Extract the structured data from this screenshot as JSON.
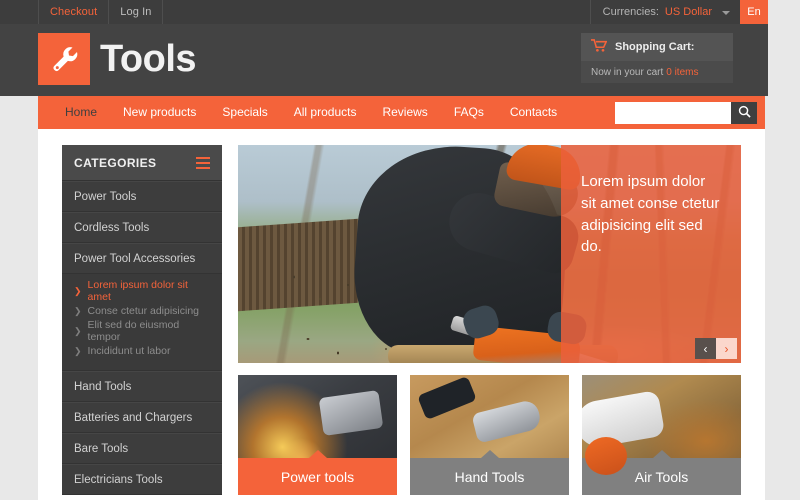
{
  "topbar": {
    "links": [
      {
        "label": "Checkout",
        "accent": true
      },
      {
        "label": "Log In",
        "accent": false
      }
    ],
    "currency_label": "Currencies:",
    "currency_value": "US Dollar",
    "language": "En"
  },
  "header": {
    "logo_text": "Tools",
    "logo_icon": "wrench-icon",
    "cart_title": "Shopping Cart:",
    "cart_icon": "shopping-cart-icon",
    "cart_status_prefix": "Now in your cart",
    "cart_count": "0 items"
  },
  "nav": {
    "items": [
      {
        "label": "Home",
        "active": true
      },
      {
        "label": "New products",
        "active": false
      },
      {
        "label": "Specials",
        "active": false
      },
      {
        "label": "All products",
        "active": false
      },
      {
        "label": "Reviews",
        "active": false
      },
      {
        "label": "FAQs",
        "active": false
      },
      {
        "label": "Contacts",
        "active": false
      }
    ],
    "search_placeholder": "",
    "search_value": "",
    "search_icon": "search-icon"
  },
  "sidebar": {
    "title": "CATEGORIES",
    "menu_icon": "hamburger-icon",
    "items": [
      {
        "label": "Power Tools"
      },
      {
        "label": "Cordless Tools"
      },
      {
        "label": "Power Tool Accessories"
      },
      {
        "label": "Hand Tools"
      },
      {
        "label": "Batteries and Chargers"
      },
      {
        "label": "Bare Tools"
      },
      {
        "label": "Electricians Tools"
      }
    ],
    "subitems": [
      {
        "label": "Lorem ipsum dolor sit amet",
        "active": true
      },
      {
        "label": "Conse ctetur adipisicing",
        "active": false
      },
      {
        "label": "Elit sed do eiusmod tempor",
        "active": false
      },
      {
        "label": "Incididunt ut labor",
        "active": false
      }
    ]
  },
  "slider": {
    "caption": "Lorem ipsum dolor sit amet conse ctetur adipisicing elit sed do.",
    "image_alt": "man using chainsaw to cut a log outdoors",
    "prev_icon": "chevron-left-icon",
    "next_icon": "chevron-right-icon",
    "prev_glyph": "‹",
    "next_glyph": "›"
  },
  "tiles": [
    {
      "label": "Power tools",
      "style": "orange",
      "image": "power",
      "image_alt": "angle grinder throwing sparks"
    },
    {
      "label": "Hand Tools",
      "style": "grey",
      "image": "hand",
      "image_alt": "claw hammer on wooden boards"
    },
    {
      "label": "Air Tools",
      "style": "grey",
      "image": "air",
      "image_alt": "stihl leaf blower over autumn leaves"
    }
  ],
  "colors": {
    "accent": "#f4633a",
    "header_dark": "#434343",
    "topbar_dark": "#3d3d3d",
    "sidebar_dark": "#3d3d3d",
    "tile_grey": "#808080",
    "page_bg": "#e8e8e8"
  }
}
